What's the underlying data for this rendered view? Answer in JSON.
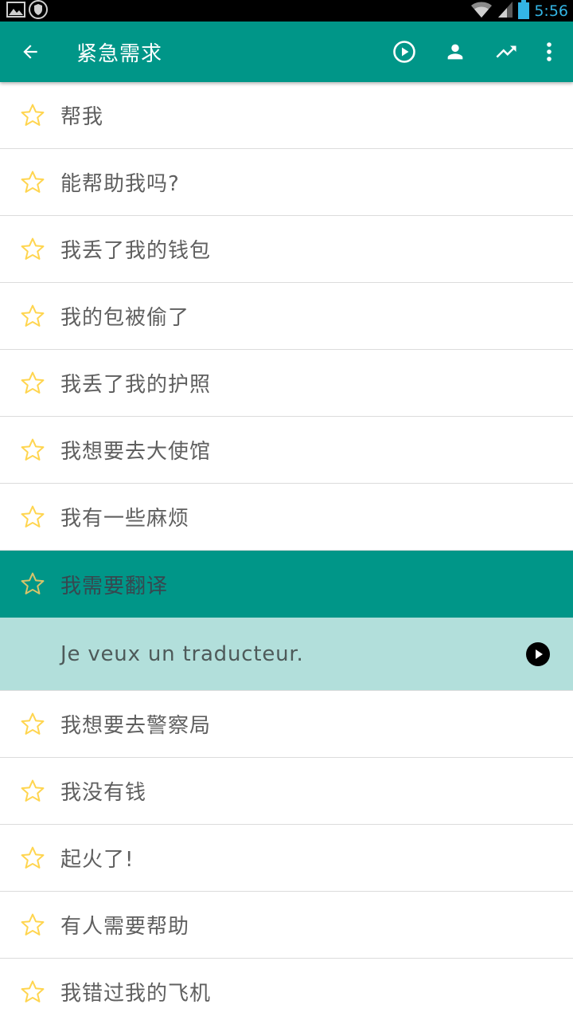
{
  "status_bar": {
    "time": "5:56",
    "icons": [
      "image-notification-icon",
      "shield-notification-icon",
      "wifi-icon",
      "signal-icon",
      "battery-icon"
    ]
  },
  "toolbar": {
    "title": "紧急需求",
    "actions": [
      "back-arrow-icon",
      "play-circle-icon",
      "person-icon",
      "trending-up-icon",
      "more-vert-icon"
    ],
    "color": "#009688"
  },
  "phrases_before": [
    {
      "text": "帮我"
    },
    {
      "text": "能帮助我吗?"
    },
    {
      "text": "我丢了我的钱包"
    },
    {
      "text": "我的包被偷了"
    },
    {
      "text": "我丢了我的护照"
    },
    {
      "text": "我想要去大使馆"
    },
    {
      "text": "我有一些麻烦"
    }
  ],
  "selected_phrase": {
    "text": "我需要翻译",
    "translation": "Je veux un traducteur."
  },
  "phrases_after": [
    {
      "text": "我想要去警察局"
    },
    {
      "text": "我没有钱"
    },
    {
      "text": "起火了!"
    },
    {
      "text": "有人需要帮助"
    },
    {
      "text": "我错过我的飞机"
    }
  ],
  "colors": {
    "accent": "#009688",
    "translation_bg": "#b2dfdb",
    "star": "#ffd54f"
  }
}
